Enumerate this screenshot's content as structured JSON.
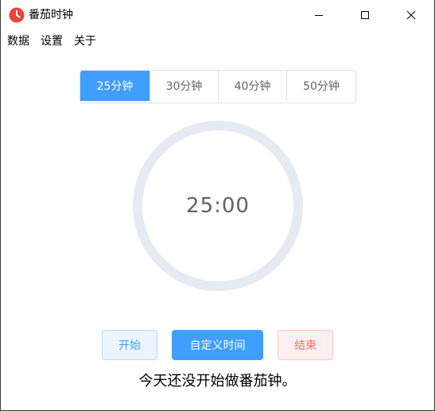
{
  "window": {
    "title": "番茄时钟",
    "icon": "clock-icon",
    "controls": [
      "minimize-icon",
      "maximize-icon",
      "close-icon"
    ]
  },
  "menu": {
    "items": [
      {
        "label": "数据"
      },
      {
        "label": "设置"
      },
      {
        "label": "关于"
      }
    ]
  },
  "durations": {
    "options": [
      {
        "label": "25分钟",
        "active": true
      },
      {
        "label": "30分钟",
        "active": false
      },
      {
        "label": "40分钟",
        "active": false
      },
      {
        "label": "50分钟",
        "active": false
      }
    ]
  },
  "timer": {
    "display": "25:00",
    "progress": 0
  },
  "actions": {
    "start_label": "开始",
    "custom_label": "自定义时间",
    "end_label": "结束"
  },
  "status": {
    "message": "今天还没开始做番茄钟。"
  },
  "colors": {
    "primary": "#409eff",
    "danger": "#f56c6c",
    "ring": "#e5eaf3",
    "icon_red": "#e8453c"
  }
}
